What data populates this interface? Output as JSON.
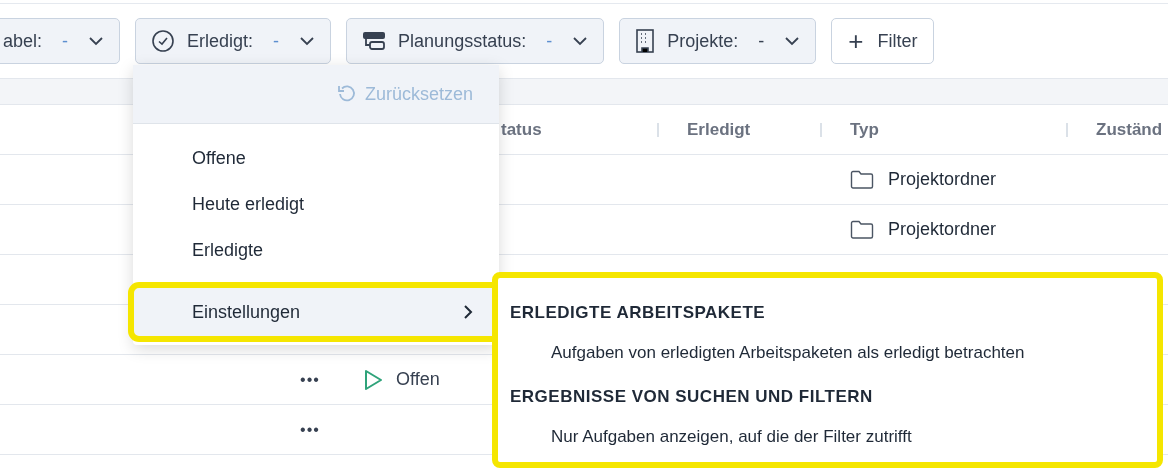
{
  "filters": [
    {
      "kind": "none",
      "label": "abel:",
      "value": "-"
    },
    {
      "kind": "check-circle",
      "label": "Erledigt:",
      "value": "-"
    },
    {
      "kind": "planning",
      "label": "Planungsstatus:",
      "value": "-"
    },
    {
      "kind": "building",
      "label": "Projekte:",
      "value": "-"
    }
  ],
  "add_filter": {
    "icon": "+",
    "label": "Filter"
  },
  "table": {
    "columns": [
      "tatus",
      "Erledigt",
      "Typ",
      "Zuständ"
    ],
    "rows": [
      {
        "type": "Projektordner"
      },
      {
        "type": "Projektordner"
      },
      {},
      {},
      {
        "actions": "•••",
        "status": "Offen"
      },
      {
        "actions": "•••"
      }
    ]
  },
  "dropdown": {
    "reset": {
      "label": "Zurücksetzen",
      "disabled": true
    },
    "items": [
      {
        "kind": "option",
        "label": "Offene",
        "selected": false
      },
      {
        "kind": "option",
        "label": "Heute erledigt",
        "selected": false
      },
      {
        "kind": "option",
        "label": "Erledigte",
        "selected": false
      },
      {
        "kind": "submenu",
        "label": "Einstellungen",
        "selected": true
      }
    ]
  },
  "submenu": {
    "sections": [
      {
        "heading": "ERLEDIGTE ARBEITSPAKETE",
        "option": "Aufgaben von erledigten Arbeitspaketen als erledigt betrachten"
      },
      {
        "heading": "ERGEBNISSE VON SUCHEN UND FILTERN",
        "option": "Nur Aufgaben anzeigen, auf die der Filter zutrifft"
      }
    ]
  }
}
